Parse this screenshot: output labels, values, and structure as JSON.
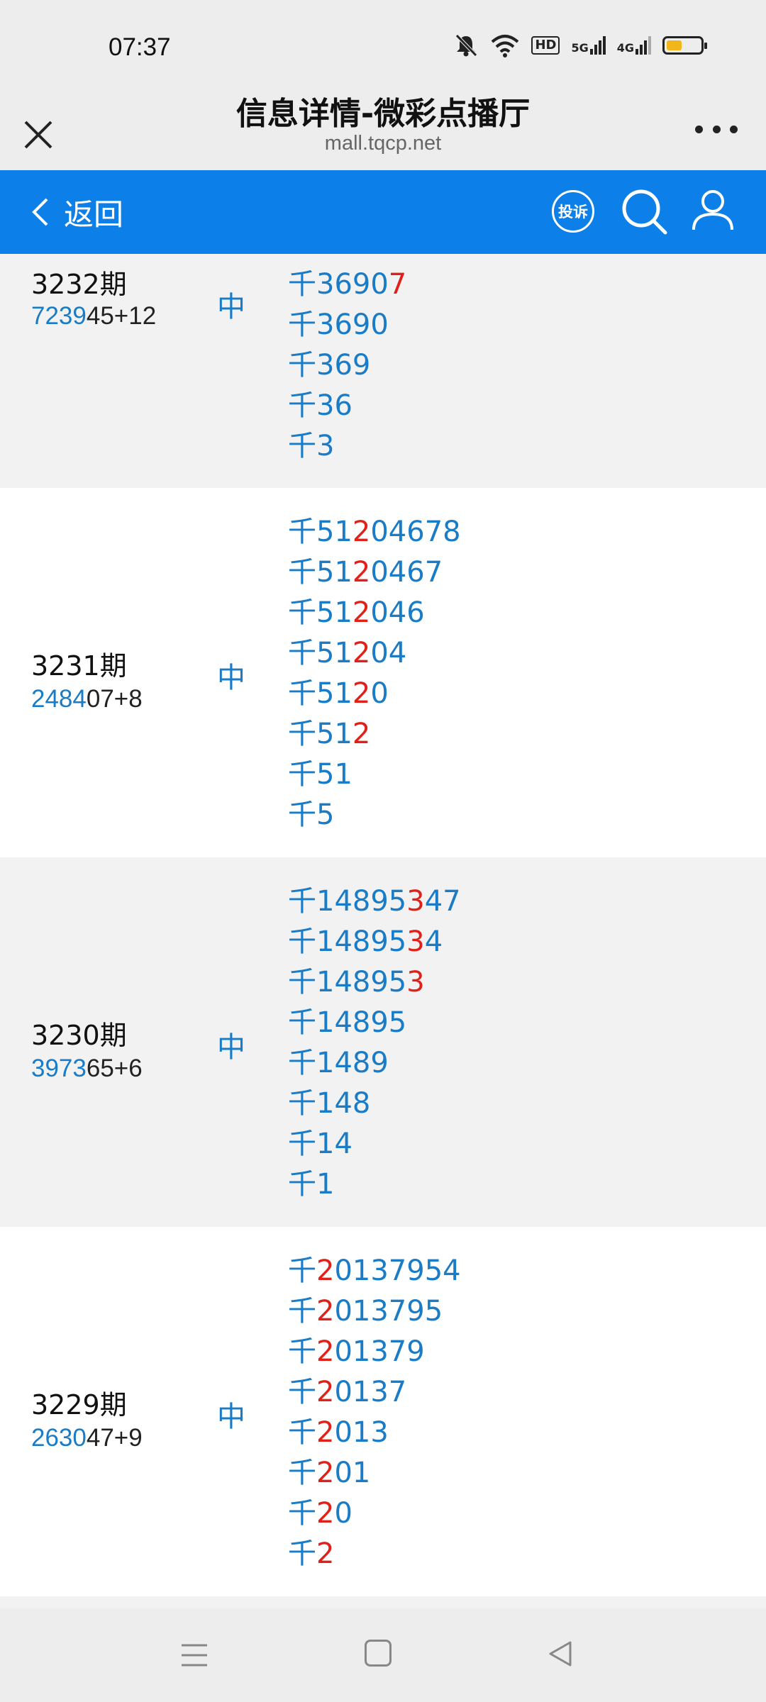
{
  "status_bar": {
    "time": "07:37",
    "icons": [
      "bell-muted-icon",
      "wifi-icon",
      "hd-icon",
      "signal-5g-icon",
      "signal-4g-icon",
      "battery-icon"
    ],
    "hd_label": "HD",
    "net1": "5G",
    "net2": "4G",
    "battery_level": 0.45,
    "battery_color": "#f2b61b"
  },
  "titlebar": {
    "title": "信息详情-微彩点播厅",
    "subtitle": "mall.tqcp.net",
    "close_icon": "close-icon",
    "more_icon": "more-icon"
  },
  "navbar": {
    "back_label": "返回",
    "complaint_label": "投诉",
    "color": "#0d7fe8"
  },
  "records": [
    {
      "period": "3232期",
      "draw_hl": "7239",
      "draw_rest": "45+12",
      "status": "中",
      "lines": [
        {
          "a": "千3690",
          "b": "7"
        },
        {
          "a": "千3690",
          "b": ""
        },
        {
          "a": "千369",
          "b": ""
        },
        {
          "a": "千36",
          "b": ""
        },
        {
          "a": "千3",
          "b": ""
        }
      ]
    },
    {
      "period": "3231期",
      "draw_hl": "2484",
      "draw_rest": "07+8",
      "status": "中",
      "lines": [
        {
          "a": "千51",
          "b": "2",
          "c": "04678"
        },
        {
          "a": "千51",
          "b": "2",
          "c": "0467"
        },
        {
          "a": "千51",
          "b": "2",
          "c": "046"
        },
        {
          "a": "千51",
          "b": "2",
          "c": "04"
        },
        {
          "a": "千51",
          "b": "2",
          "c": "0"
        },
        {
          "a": "千51",
          "b": "2",
          "c": ""
        },
        {
          "a": "千51",
          "b": "",
          "c": ""
        },
        {
          "a": "千5",
          "b": "",
          "c": ""
        }
      ]
    },
    {
      "period": "3230期",
      "draw_hl": "3973",
      "draw_rest": "65+6",
      "status": "中",
      "lines": [
        {
          "a": "千14895",
          "b": "3",
          "c": "47"
        },
        {
          "a": "千14895",
          "b": "3",
          "c": "4"
        },
        {
          "a": "千14895",
          "b": "3",
          "c": ""
        },
        {
          "a": "千14895",
          "b": "",
          "c": ""
        },
        {
          "a": "千1489",
          "b": "",
          "c": ""
        },
        {
          "a": "千148",
          "b": "",
          "c": ""
        },
        {
          "a": "千14",
          "b": "",
          "c": ""
        },
        {
          "a": "千1",
          "b": "",
          "c": ""
        }
      ]
    },
    {
      "period": "3229期",
      "draw_hl": "2630",
      "draw_rest": "47+9",
      "status": "中",
      "lines": [
        {
          "a": "千",
          "b": "2",
          "c": "0137954"
        },
        {
          "a": "千",
          "b": "2",
          "c": "013795"
        },
        {
          "a": "千",
          "b": "2",
          "c": "01379"
        },
        {
          "a": "千",
          "b": "2",
          "c": "0137"
        },
        {
          "a": "千",
          "b": "2",
          "c": "013"
        },
        {
          "a": "千",
          "b": "2",
          "c": "01"
        },
        {
          "a": "千",
          "b": "2",
          "c": "0"
        },
        {
          "a": "千",
          "b": "2",
          "c": ""
        }
      ]
    }
  ],
  "bottom_nav": {
    "icons": [
      "menu-icon",
      "home-square-icon",
      "back-triangle-icon"
    ]
  }
}
